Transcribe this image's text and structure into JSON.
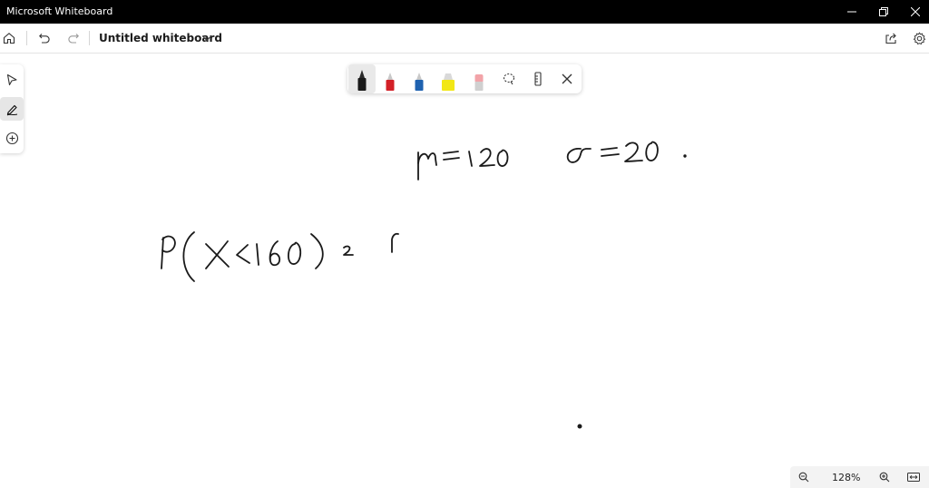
{
  "window": {
    "title": "Microsoft Whiteboard"
  },
  "toolbar": {
    "document_title": "Untitled whiteboard",
    "icons": [
      "home-icon",
      "undo-icon",
      "redo-icon",
      "chevron-down-icon",
      "share-icon",
      "settings-icon"
    ]
  },
  "sidebar": {
    "tools": [
      "select-icon",
      "inking-icon",
      "add-icon"
    ]
  },
  "ink_toolbar": {
    "pens": [
      {
        "name": "black-pen",
        "color": "#1a1a1a"
      },
      {
        "name": "red-pen",
        "color": "#d32027"
      },
      {
        "name": "blue-pen",
        "color": "#1f62b0"
      },
      {
        "name": "yellow-highlighter",
        "color": "#f2e716"
      },
      {
        "name": "eraser",
        "color": "#f2a3a8"
      }
    ],
    "tools": [
      "lasso-icon",
      "ruler-icon",
      "close-icon"
    ]
  },
  "zoom": {
    "level": "128%"
  },
  "colors": {
    "titlebar": "#000000",
    "ink": "#1a1a1a"
  }
}
